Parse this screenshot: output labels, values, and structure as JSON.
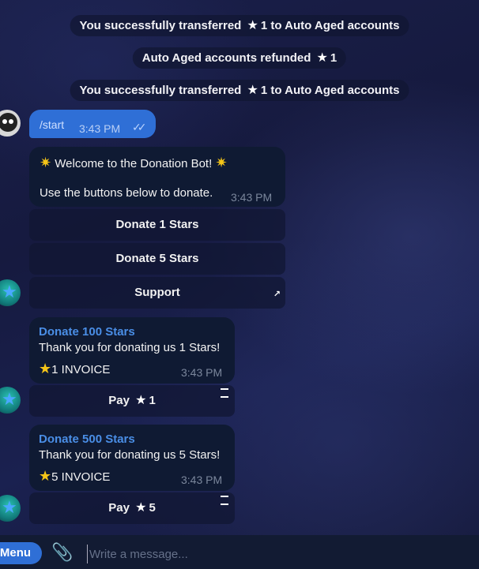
{
  "service": {
    "m1": {
      "pre": "You successfully transferred",
      "amt": "1",
      "post": "to Auto Aged accounts"
    },
    "m2": {
      "pre": "Auto Aged accounts refunded",
      "amt": "1"
    },
    "m3": {
      "pre": "You successfully transferred",
      "amt": "1",
      "post": "to Auto Aged accounts"
    }
  },
  "outgoing": {
    "command": "/start",
    "time": "3:43 PM"
  },
  "welcome": {
    "line1": "Welcome to the Donation Bot!",
    "line2": "Use the buttons below to donate.",
    "time": "3:43 PM",
    "buttons": [
      "Donate 1 Stars",
      "Donate 5 Stars",
      "Support"
    ]
  },
  "invoice1": {
    "title": "Donate 100 Stars",
    "desc": "Thank you for donating us 1 Stars!",
    "amount": "1 INVOICE",
    "time": "3:43 PM",
    "pay_label": "Pay",
    "pay_amount": "1"
  },
  "invoice2": {
    "title": "Donate 500 Stars",
    "desc": "Thank you for donating us 5 Stars!",
    "amount": "5 INVOICE",
    "time": "3:43 PM",
    "pay_label": "Pay",
    "pay_amount": "5"
  },
  "composer": {
    "menu_label": "Menu",
    "placeholder": "Write a message..."
  },
  "icons": {
    "star": "star-icon",
    "sparkle": "sparkle-emoji-icon",
    "attach": "paperclip-icon"
  }
}
